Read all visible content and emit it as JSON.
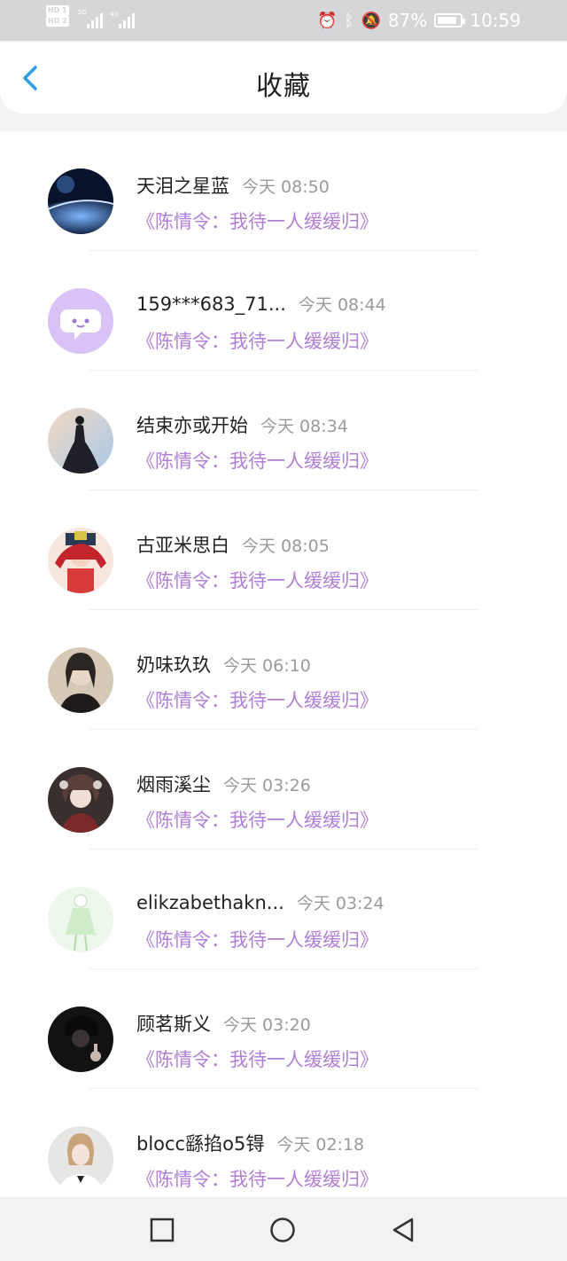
{
  "status_bar": {
    "sim1_label": "HD 1",
    "sim2_label": "HD 2",
    "net1": "5G",
    "net2": "4G",
    "battery": "87%",
    "battery_level": 0.87,
    "time": "10:59",
    "icons": [
      "alarm-icon",
      "bluetooth-icon",
      "mute-icon"
    ]
  },
  "header": {
    "title": "收藏",
    "back_icon": "chevron-left-icon",
    "accent": "#2aa0e6"
  },
  "list": {
    "title_color": "#b07fd6",
    "items": [
      {
        "name": "天泪之星蓝",
        "time": "今天 08:50",
        "title": "《陈情令：我待一人缓缓归》",
        "avatar": "planet-avatar"
      },
      {
        "name": "159***683_71...",
        "time": "今天 08:44",
        "title": "《陈情令：我待一人缓缓归》",
        "avatar": "default-chat-avatar"
      },
      {
        "name": "结束亦或开始",
        "time": "今天 08:34",
        "title": "《陈情令：我待一人缓缓归》",
        "avatar": "silhouette-avatar"
      },
      {
        "name": "古亚米思白",
        "time": "今天 08:05",
        "title": "《陈情令：我待一人缓缓归》",
        "avatar": "anime-avatar"
      },
      {
        "name": "奶味玖玖",
        "time": "今天 06:10",
        "title": "《陈情令：我待一人缓缓归》",
        "avatar": "portrait-avatar"
      },
      {
        "name": "烟雨溪尘",
        "time": "今天 03:26",
        "title": "《陈情令：我待一人缓缓归》",
        "avatar": "illustration-avatar"
      },
      {
        "name": "elikzabethakn...",
        "time": "今天 03:24",
        "title": "《陈情令：我待一人缓缓归》",
        "avatar": "sketch-avatar"
      },
      {
        "name": "顾茗斯义",
        "time": "今天 03:20",
        "title": "《陈情令：我待一人缓缓归》",
        "avatar": "dark-portrait-avatar"
      },
      {
        "name": "blocc繇掐o5锝",
        "time": "今天 02:18",
        "title": "《陈情令：我待一人缓缓归》",
        "avatar": "girl-portrait-avatar"
      }
    ]
  },
  "system_nav": {
    "buttons": [
      "recents-square-icon",
      "home-circle-icon",
      "back-triangle-icon"
    ]
  }
}
